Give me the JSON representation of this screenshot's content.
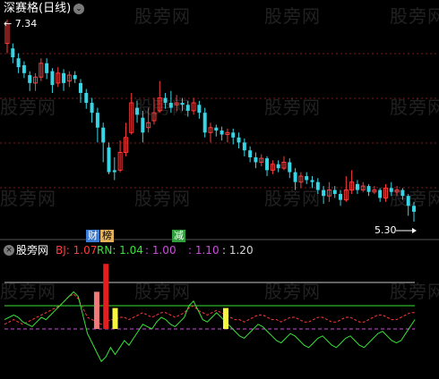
{
  "main_panel": {
    "title": "深赛格(日线)",
    "high_label": "7.34",
    "low_label": "5.30",
    "badges": [
      {
        "text": "财",
        "color": "#3a7bd5"
      },
      {
        "text": "榜",
        "color": "#e3b25a"
      },
      {
        "text": "减",
        "color": "#39c04a"
      }
    ]
  },
  "indicator_panel": {
    "name": "股旁网",
    "bj_label": "BJ: 1.07",
    "rn_label": "RN: 1.04",
    "v3_label": ": 1.00",
    "v4_label": ": 1.10",
    "v5_label": ": 1.20"
  },
  "watermark": "股旁网",
  "colors": {
    "up_candle": "#ff3b3b",
    "down_candle": "#36d6e6",
    "bj_color": "#ff3b3b",
    "rn_color": "#39e339",
    "purple": "#d24be0",
    "white_line": "#c8c8c8",
    "green_line": "#39e339"
  },
  "chart_data": {
    "type": "candlestick",
    "price_range": [
      5.3,
      7.34
    ],
    "candles": [
      [
        7.1,
        7.3,
        7.34,
        7.0
      ],
      [
        7.05,
        6.96,
        7.1,
        6.9
      ],
      [
        6.95,
        6.86,
        7.0,
        6.8
      ],
      [
        6.88,
        6.8,
        6.92,
        6.75
      ],
      [
        6.78,
        6.7,
        6.82,
        6.62
      ],
      [
        6.7,
        6.76,
        6.8,
        6.62
      ],
      [
        6.76,
        6.9,
        6.95,
        6.72
      ],
      [
        6.9,
        6.8,
        6.95,
        6.74
      ],
      [
        6.82,
        6.68,
        6.85,
        6.6
      ],
      [
        6.7,
        6.8,
        6.86,
        6.66
      ],
      [
        6.8,
        6.7,
        6.84,
        6.62
      ],
      [
        6.72,
        6.78,
        6.82,
        6.66
      ],
      [
        6.78,
        6.74,
        6.82,
        6.7
      ],
      [
        6.7,
        6.6,
        6.74,
        6.5
      ],
      [
        6.6,
        6.5,
        6.64,
        6.44
      ],
      [
        6.5,
        6.4,
        6.55,
        6.3
      ],
      [
        6.4,
        6.25,
        6.45,
        6.1
      ],
      [
        6.25,
        6.1,
        6.3,
        5.9
      ],
      [
        6.05,
        5.8,
        6.1,
        5.78
      ],
      [
        5.82,
        5.8,
        5.95,
        5.72
      ],
      [
        5.82,
        6.0,
        6.12,
        5.8
      ],
      [
        6.0,
        6.15,
        6.3,
        5.96
      ],
      [
        6.2,
        6.5,
        6.6,
        6.18
      ],
      [
        6.45,
        6.38,
        6.52,
        6.3
      ],
      [
        6.35,
        6.2,
        6.42,
        6.1
      ],
      [
        6.25,
        6.3,
        6.45,
        6.2
      ],
      [
        6.32,
        6.4,
        6.55,
        6.28
      ],
      [
        6.42,
        6.55,
        6.72,
        6.4
      ],
      [
        6.55,
        6.5,
        6.6,
        6.44
      ],
      [
        6.5,
        6.45,
        6.62,
        6.4
      ],
      [
        6.48,
        6.5,
        6.58,
        6.42
      ],
      [
        6.5,
        6.48,
        6.55,
        6.42
      ],
      [
        6.48,
        6.42,
        6.52,
        6.36
      ],
      [
        6.42,
        6.5,
        6.55,
        6.38
      ],
      [
        6.48,
        6.4,
        6.52,
        6.34
      ],
      [
        6.4,
        6.2,
        6.45,
        6.15
      ],
      [
        6.2,
        6.25,
        6.3,
        6.1
      ],
      [
        6.25,
        6.22,
        6.28,
        6.16
      ],
      [
        6.22,
        6.18,
        6.26,
        6.12
      ],
      [
        6.18,
        6.2,
        6.24,
        6.1
      ],
      [
        6.2,
        6.15,
        6.24,
        6.08
      ],
      [
        6.15,
        6.1,
        6.2,
        6.04
      ],
      [
        6.1,
        6.02,
        6.14,
        5.96
      ],
      [
        6.02,
        5.95,
        6.06,
        5.9
      ],
      [
        5.95,
        5.9,
        6.0,
        5.84
      ],
      [
        5.9,
        5.94,
        5.98,
        5.86
      ],
      [
        5.94,
        5.82,
        5.96,
        5.76
      ],
      [
        5.82,
        5.88,
        5.92,
        5.78
      ],
      [
        5.88,
        5.84,
        5.92,
        5.8
      ],
      [
        5.84,
        5.9,
        5.96,
        5.82
      ],
      [
        5.9,
        5.8,
        5.94,
        5.74
      ],
      [
        5.8,
        5.7,
        5.84,
        5.62
      ],
      [
        5.7,
        5.76,
        5.8,
        5.64
      ],
      [
        5.76,
        5.72,
        5.8,
        5.68
      ],
      [
        5.72,
        5.7,
        5.76,
        5.64
      ],
      [
        5.7,
        5.62,
        5.74,
        5.58
      ],
      [
        5.62,
        5.56,
        5.66,
        5.48
      ],
      [
        5.56,
        5.62,
        5.7,
        5.5
      ],
      [
        5.62,
        5.58,
        5.66,
        5.54
      ],
      [
        5.58,
        5.52,
        5.62,
        5.46
      ],
      [
        5.52,
        5.62,
        5.76,
        5.5
      ],
      [
        5.62,
        5.7,
        5.82,
        5.58
      ],
      [
        5.68,
        5.62,
        5.72,
        5.58
      ],
      [
        5.62,
        5.66,
        5.7,
        5.6
      ],
      [
        5.66,
        5.6,
        5.68,
        5.56
      ],
      [
        5.6,
        5.62,
        5.66,
        5.58
      ],
      [
        5.62,
        5.54,
        5.64,
        5.5
      ],
      [
        5.54,
        5.64,
        5.68,
        5.5
      ],
      [
        5.64,
        5.6,
        5.7,
        5.56
      ],
      [
        5.6,
        5.62,
        5.66,
        5.56
      ],
      [
        5.62,
        5.56,
        5.64,
        5.52
      ],
      [
        5.56,
        5.46,
        5.58,
        5.36
      ],
      [
        5.46,
        5.4,
        5.5,
        5.3
      ]
    ],
    "indicator_range": [
      0.8,
      1.3
    ],
    "ref_lines": [
      {
        "value": 1.0,
        "color": "#d24be0"
      },
      {
        "value": 1.1,
        "color": "#39e339"
      },
      {
        "value": 1.2,
        "color": "#c8c8c8"
      }
    ],
    "rn_series": [
      1.04,
      1.05,
      1.06,
      1.05,
      1.03,
      1.02,
      1.01,
      1.03,
      1.05,
      1.04,
      1.06,
      1.08,
      1.1,
      1.12,
      1.14,
      1.16,
      1.14,
      1.06,
      0.98,
      0.94,
      0.9,
      0.86,
      0.88,
      0.92,
      0.89,
      0.92,
      0.95,
      0.93,
      0.96,
      0.99,
      1.02,
      1.01,
      1.0,
      1.03,
      1.05,
      1.04,
      1.02,
      1.01,
      1.03,
      1.05,
      1.1,
      1.12,
      1.08,
      1.04,
      1.03,
      1.05,
      1.07,
      1.05,
      1.03,
      1.01,
      0.99,
      0.97,
      0.96,
      0.98,
      1.0,
      1.02,
      1.01,
      0.99,
      0.97,
      0.95,
      0.94,
      0.96,
      0.98,
      0.97,
      0.95,
      0.93,
      0.92,
      0.94,
      0.96,
      0.97,
      0.95,
      0.93,
      0.92,
      0.94,
      0.96,
      0.97,
      0.95,
      0.93,
      0.92,
      0.94,
      0.96,
      0.98,
      0.99,
      0.97,
      0.95,
      0.94,
      0.95,
      0.98,
      1.01,
      1.04
    ],
    "bj_series": [
      1.02,
      1.03,
      1.04,
      1.03,
      1.02,
      1.03,
      1.04,
      1.05,
      1.06,
      1.07,
      1.08,
      1.09,
      1.1,
      1.12,
      1.14,
      1.15,
      1.13,
      1.09,
      1.05,
      1.04,
      1.03,
      1.02,
      1.03,
      1.04,
      1.04,
      1.05,
      1.05,
      1.04,
      1.05,
      1.06,
      1.07,
      1.06,
      1.05,
      1.06,
      1.07,
      1.07,
      1.06,
      1.05,
      1.06,
      1.07,
      1.09,
      1.1,
      1.08,
      1.07,
      1.06,
      1.07,
      1.08,
      1.07,
      1.06,
      1.05,
      1.04,
      1.04,
      1.03,
      1.04,
      1.05,
      1.06,
      1.06,
      1.05,
      1.04,
      1.04,
      1.03,
      1.04,
      1.05,
      1.05,
      1.04,
      1.03,
      1.03,
      1.04,
      1.05,
      1.05,
      1.04,
      1.03,
      1.03,
      1.04,
      1.05,
      1.05,
      1.04,
      1.03,
      1.03,
      1.04,
      1.05,
      1.06,
      1.06,
      1.05,
      1.04,
      1.04,
      1.05,
      1.06,
      1.07,
      1.07
    ],
    "bars": [
      {
        "x_index": 20,
        "bottom": 1.0,
        "top": 1.16,
        "color": "#f07a7a"
      },
      {
        "x_index": 22,
        "bottom": 1.0,
        "top": 1.28,
        "color": "#e31e1e"
      },
      {
        "x_index": 24,
        "bottom": 1.0,
        "top": 1.09,
        "color": "#f5f542"
      },
      {
        "x_index": 48,
        "bottom": 1.0,
        "top": 1.09,
        "color": "#f5f542"
      }
    ]
  }
}
